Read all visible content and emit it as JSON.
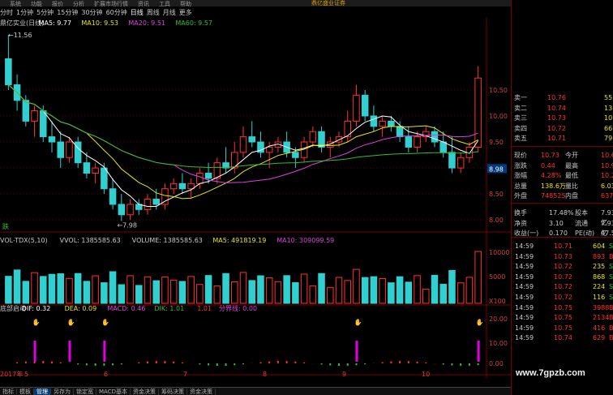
{
  "menu": [
    "系统",
    "功能",
    "报价",
    "分析",
    "扩展市场行情",
    "资讯",
    "工具",
    "帮助"
  ],
  "menu_brand": "鼎亿盛业证券",
  "periods": [
    "分时",
    "1分钟",
    "5分钟",
    "15分钟",
    "30分钟",
    "60分钟",
    "日线",
    "周线",
    "月线",
    "更多"
  ],
  "active_period": "日线",
  "main_legend": {
    "name": "鼎亿实业(日线)",
    "ma5": "MA5: 9.77",
    "ma10": "MA10: 9.53",
    "ma20": "MA20: 9.51",
    "ma60": "MA60: 9.57"
  },
  "high_label": "←11.56",
  "low_label": "←7.98",
  "die_label": "跌",
  "last_price_tag": "8.98",
  "price_axis": [
    "10.50",
    "10.00",
    "9.50",
    "9.00",
    "8.50",
    "8.00"
  ],
  "vol_legend": {
    "name": "VOL-TDX(5,10)",
    "vvol": "VVOL: 1385585.63",
    "volume": "VOLUME: 1385585.63",
    "ma5": "MA5: 491819.19",
    "ma10": "MA10: 309099.59"
  },
  "vol_axis": [
    "10000",
    "5000",
    "X100"
  ],
  "macd_legend": {
    "name": "底部启动",
    "dif": "DIF: 0.32",
    "dea": "DEA: 0.09",
    "macd": "MACD: 0.46",
    "dik": "DIK: 1.01",
    "one": "1.01",
    "line": "分界线: 0.00"
  },
  "macd_axis": [
    "20.00",
    "10.00",
    "0.00"
  ],
  "date_axis": [
    "2017年",
    "5",
    "6",
    "7",
    "8",
    "9",
    "10"
  ],
  "quotes_asks": [
    {
      "label": "卖一",
      "price": "10.76",
      "vol": "55"
    },
    {
      "label": "卖二",
      "price": "10.74",
      "vol": "13"
    },
    {
      "label": "卖三",
      "price": "10.73",
      "vol": "101"
    },
    {
      "label": "卖四",
      "price": "10.72",
      "vol": "66"
    },
    {
      "label": "卖五",
      "price": "10.71",
      "vol": "79"
    }
  ],
  "stats": [
    {
      "l1": "现价",
      "v1": "10.73",
      "l2": "今开",
      "v2": "10.60"
    },
    {
      "l1": "涨跌",
      "v1": "0.44",
      "l2": "最高",
      "v2": "10.96"
    },
    {
      "l1": "涨幅",
      "v1": "4.28%",
      "l2": "最低",
      "v2": "10.25"
    },
    {
      "l1": "总量",
      "v1": "138.6万",
      "l2": "量比",
      "v2": "6.03"
    },
    {
      "l1": "外盘",
      "v1": "748525",
      "l2": "内盘",
      "v2": "637060"
    }
  ],
  "stats2": [
    {
      "l1": "换手",
      "v1": "17.48%",
      "l2": "股本",
      "v2": "7.93亿"
    },
    {
      "l1": "净资",
      "v1": "3.10",
      "l2": "流通",
      "v2": "7.93亿"
    },
    {
      "l1": "收益(一)",
      "v1": "0.170",
      "l2": "PE(动)",
      "v2": "47.5"
    }
  ],
  "ticks": [
    {
      "t": "14:59",
      "p": "10.71",
      "v": "604",
      "d": "S"
    },
    {
      "t": "14:59",
      "p": "10.73",
      "v": "893",
      "d": "B"
    },
    {
      "t": "14:59",
      "p": "10.72",
      "v": "235",
      "d": "S"
    },
    {
      "t": "14:59",
      "p": "10.72",
      "v": "868",
      "d": "S"
    },
    {
      "t": "14:59",
      "p": "10.72",
      "v": "224",
      "d": "S"
    },
    {
      "t": "14:59",
      "p": "10.72",
      "v": "116",
      "d": "S"
    },
    {
      "t": "14:59",
      "p": "10.75",
      "v": "3988",
      "d": "B"
    },
    {
      "t": "14:59",
      "p": "10.75",
      "v": "2134",
      "d": "B"
    },
    {
      "t": "14:59",
      "p": "10.75",
      "v": "416",
      "d": "B"
    },
    {
      "t": "14:59",
      "p": "10.74",
      "v": "629",
      "d": "B"
    }
  ],
  "tabs": [
    "指标",
    "模板",
    "管理",
    "另存为",
    "锁定宽",
    "MACD基本",
    "资金决策",
    "筹码决策",
    "资金决策"
  ],
  "active_tab": "管理",
  "watermark": "www.7gpzb.com",
  "chart_data": {
    "type": "candlestick",
    "x_range": [
      "2017-04",
      "2017-10"
    ],
    "price_range": [
      7.98,
      11.56
    ],
    "ohlc": [
      [
        11.1,
        11.56,
        10.5,
        10.6
      ],
      [
        10.6,
        10.8,
        10.1,
        10.3
      ],
      [
        10.3,
        10.4,
        9.8,
        9.9
      ],
      [
        9.9,
        10.2,
        9.6,
        10.1
      ],
      [
        10.1,
        10.2,
        9.5,
        9.6
      ],
      [
        9.6,
        9.9,
        9.3,
        9.5
      ],
      [
        9.5,
        9.7,
        9.0,
        9.2
      ],
      [
        9.2,
        9.6,
        9.1,
        9.5
      ],
      [
        9.5,
        9.6,
        9.0,
        9.1
      ],
      [
        9.1,
        9.3,
        8.8,
        8.9
      ],
      [
        8.9,
        9.1,
        8.7,
        9.0
      ],
      [
        9.0,
        9.1,
        8.5,
        8.6
      ],
      [
        8.6,
        8.8,
        8.2,
        8.3
      ],
      [
        8.3,
        8.5,
        7.98,
        8.1
      ],
      [
        8.1,
        8.4,
        8.0,
        8.3
      ],
      [
        8.3,
        8.4,
        8.1,
        8.2
      ],
      [
        8.2,
        8.5,
        8.1,
        8.4
      ],
      [
        8.4,
        8.6,
        8.2,
        8.3
      ],
      [
        8.3,
        8.7,
        8.2,
        8.6
      ],
      [
        8.6,
        8.8,
        8.5,
        8.7
      ],
      [
        8.7,
        8.9,
        8.5,
        8.6
      ],
      [
        8.6,
        8.8,
        8.4,
        8.7
      ],
      [
        8.7,
        9.0,
        8.6,
        8.9
      ],
      [
        8.9,
        9.1,
        8.7,
        8.8
      ],
      [
        8.8,
        9.2,
        8.7,
        9.1
      ],
      [
        9.1,
        9.4,
        8.9,
        9.0
      ],
      [
        9.0,
        9.5,
        8.9,
        9.3
      ],
      [
        9.3,
        9.8,
        9.2,
        9.6
      ],
      [
        9.6,
        9.9,
        9.4,
        9.5
      ],
      [
        9.5,
        9.7,
        9.2,
        9.3
      ],
      [
        9.3,
        9.5,
        9.0,
        9.4
      ],
      [
        9.4,
        9.6,
        9.3,
        9.5
      ],
      [
        9.5,
        9.7,
        9.2,
        9.3
      ],
      [
        9.3,
        9.4,
        9.0,
        9.2
      ],
      [
        9.2,
        9.6,
        9.1,
        9.5
      ],
      [
        9.5,
        9.8,
        9.4,
        9.7
      ],
      [
        9.7,
        9.8,
        9.3,
        9.4
      ],
      [
        9.4,
        9.6,
        9.2,
        9.5
      ],
      [
        9.5,
        9.7,
        9.4,
        9.6
      ],
      [
        9.6,
        10.1,
        9.5,
        9.9
      ],
      [
        9.9,
        10.6,
        9.8,
        10.4
      ],
      [
        10.4,
        10.5,
        9.9,
        10.0
      ],
      [
        10.0,
        10.2,
        9.7,
        9.8
      ],
      [
        9.8,
        10.0,
        9.6,
        9.9
      ],
      [
        9.9,
        10.0,
        9.7,
        9.8
      ],
      [
        9.8,
        9.9,
        9.5,
        9.6
      ],
      [
        9.6,
        9.8,
        9.3,
        9.4
      ],
      [
        9.4,
        9.7,
        9.3,
        9.6
      ],
      [
        9.6,
        9.8,
        9.5,
        9.7
      ],
      [
        9.7,
        9.8,
        9.4,
        9.5
      ],
      [
        9.5,
        9.7,
        9.2,
        9.3
      ],
      [
        9.3,
        9.6,
        8.9,
        9.0
      ],
      [
        9.0,
        9.3,
        8.9,
        9.2
      ],
      [
        9.2,
        9.5,
        9.1,
        9.4
      ],
      [
        9.4,
        10.96,
        9.3,
        10.73
      ]
    ]
  }
}
